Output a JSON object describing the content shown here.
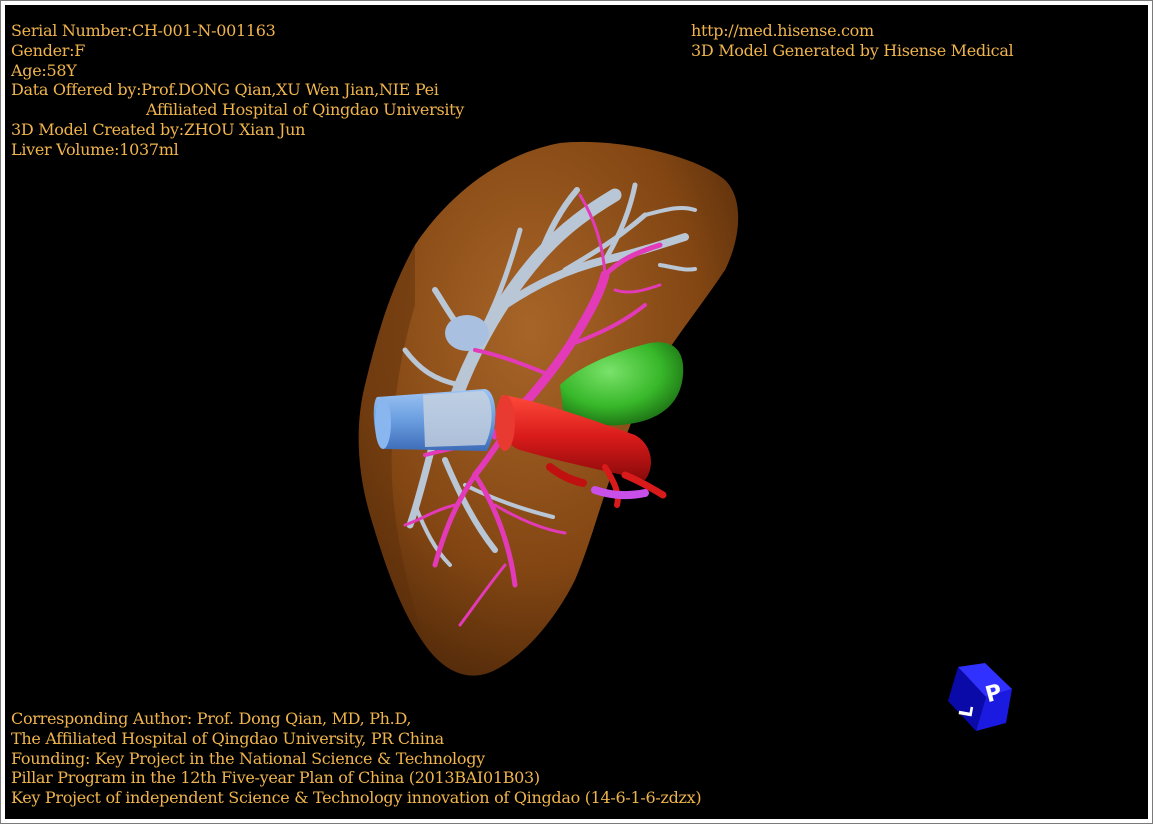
{
  "info": {
    "serial": "Serial Number:CH-001-N-001163",
    "gender": "Gender:F",
    "age": "Age:58Y",
    "data_offered": "Data Offered by:Prof.DONG Qian,XU Wen Jian,NIE Pei",
    "hospital": "Affiliated Hospital of Qingdao University",
    "model_created": "3D Model Created by:ZHOU Xian Jun",
    "liver_volume": "Liver Volume:1037ml"
  },
  "brand": {
    "url": "http://med.hisense.com",
    "generated": "3D Model Generated by Hisense Medical"
  },
  "credits": {
    "author": "Corresponding Author: Prof. Dong Qian, MD, Ph.D,",
    "affiliation": "The Affiliated Hospital of Qingdao University, PR China",
    "founding": "Founding: Key Project in the National Science & Technology",
    "pillar": "Pillar Program in the 12th Five-year Plan of China (2013BAI01B03)",
    "key_project": "Key Project of independent Science & Technology innovation of Qingdao (14-6-1-6-zdzx)"
  },
  "cube": {
    "label_front": "P",
    "label_side": "L"
  },
  "colors": {
    "text": "#f0b44c",
    "background": "#000000",
    "liver": "#8a4a14",
    "portal_vein": "#e23ab8",
    "hepatic_vein": "#b9c6d6",
    "vena_cava": "#6a9ee0",
    "aorta": "#d81a1a",
    "gallbladder": "#38b82a",
    "cube": "#1414c8"
  }
}
